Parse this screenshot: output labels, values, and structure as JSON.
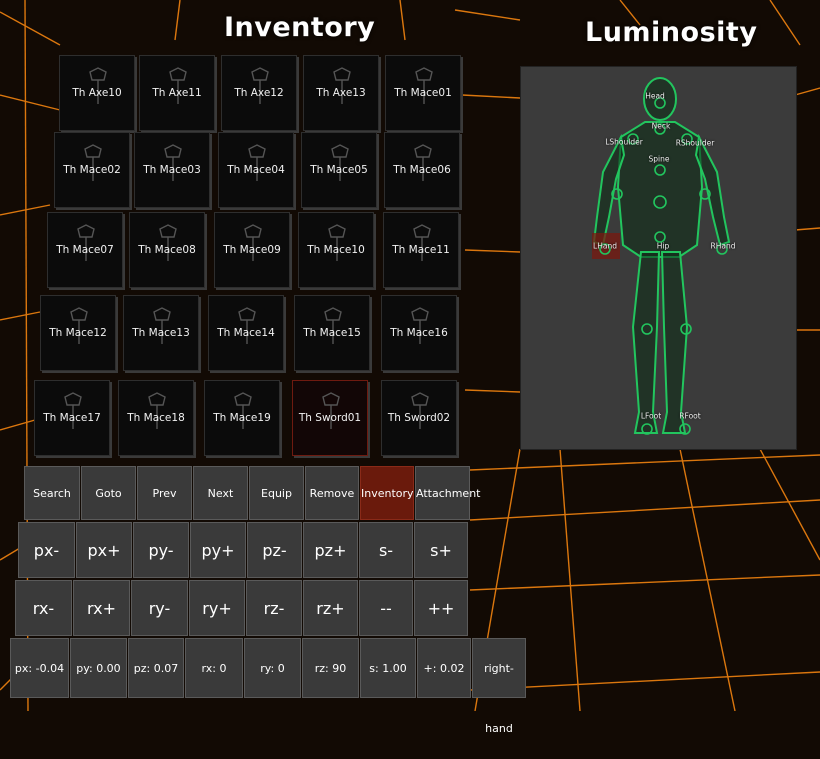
{
  "inventory_title": "Inventory",
  "luminosity_title": "Luminosity",
  "colors": {
    "grid": "#ff8a10",
    "panel": "#3b3b3b",
    "skeleton": "#22c55e",
    "active_button": "#6a1a0c"
  },
  "items": [
    {
      "label": "Th Axe10"
    },
    {
      "label": "Th Axe11"
    },
    {
      "label": "Th Axe12"
    },
    {
      "label": "Th Axe13"
    },
    {
      "label": "Th Mace01"
    },
    {
      "label": "Th Mace02"
    },
    {
      "label": "Th Mace03"
    },
    {
      "label": "Th Mace04"
    },
    {
      "label": "Th Mace05"
    },
    {
      "label": "Th Mace06"
    },
    {
      "label": "Th Mace07"
    },
    {
      "label": "Th Mace08"
    },
    {
      "label": "Th Mace09"
    },
    {
      "label": "Th Mace10"
    },
    {
      "label": "Th Mace11"
    },
    {
      "label": "Th Mace12"
    },
    {
      "label": "Th Mace13"
    },
    {
      "label": "Th Mace14"
    },
    {
      "label": "Th Mace15"
    },
    {
      "label": "Th Mace16"
    },
    {
      "label": "Th Mace17"
    },
    {
      "label": "Th Mace18"
    },
    {
      "label": "Th Mace19"
    },
    {
      "label": "Th Sword01",
      "selected": true
    },
    {
      "label": "Th Sword02"
    }
  ],
  "actions": [
    "Search",
    "Goto",
    "Prev",
    "Next",
    "Equip",
    "Remove",
    "Inventory",
    "Attachment"
  ],
  "active_action": "Inventory",
  "pos_buttons": [
    "px-",
    "px+",
    "py-",
    "py+",
    "pz-",
    "pz+",
    "s-",
    "s+"
  ],
  "rot_buttons": [
    "rx-",
    "rx+",
    "ry-",
    "ry+",
    "rz-",
    "rz+",
    "--",
    "++"
  ],
  "values": [
    "px: -0.04",
    "py: 0.00",
    "pz: 0.07",
    "rx: 0",
    "ry: 0",
    "rz: 90",
    "s: 1.00",
    "+: 0.02",
    "right-hand"
  ],
  "joints": {
    "head": "Head",
    "neck": "Neck",
    "lshoulder": "LShoulder",
    "rshoulder": "RShoulder",
    "spine": "Spine",
    "lhand": "LHand",
    "hip": "Hip",
    "rhand": "RHand",
    "lfoot": "LFoot",
    "rfoot": "RFoot"
  }
}
